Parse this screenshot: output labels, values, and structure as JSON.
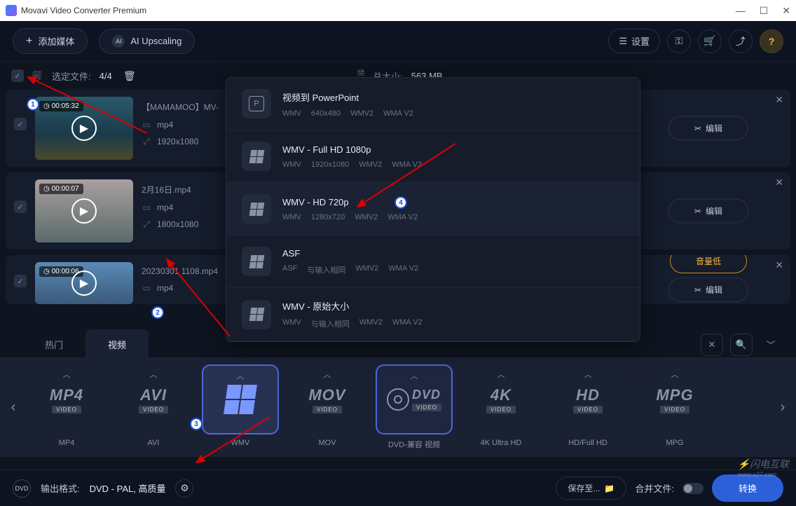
{
  "window": {
    "title": "Movavi Video Converter Premium"
  },
  "toolbar": {
    "add_media": "添加媒体",
    "ai_upscaling": "AI Upscaling",
    "settings": "设置"
  },
  "infobar": {
    "selected_label": "选定文件:",
    "selected_count": "4/4",
    "total_label": "总大小:",
    "total_size": "563 MB"
  },
  "files": [
    {
      "duration": "00:05:32",
      "name": "【MAMAMOO】MV-",
      "format": "mp4",
      "resolution": "1920x1080",
      "edit": "编辑"
    },
    {
      "duration": "00:00:07",
      "name": "2月16日.mp4",
      "format": "mp4",
      "resolution": "1800x1080",
      "edit": "编辑"
    },
    {
      "duration": "00:00:06",
      "name": "20230301 1108.mp4",
      "format": "mp4",
      "resolution": "",
      "warn": "音量低",
      "edit": "编辑"
    }
  ],
  "presets": [
    {
      "title": "视频到 PowerPoint",
      "specs": [
        "WMV",
        "640x480",
        "WMV2",
        "WMA V2"
      ],
      "icon": "ppt"
    },
    {
      "title": "WMV - Full HD 1080p",
      "specs": [
        "WMV",
        "1920x1080",
        "WMV2",
        "WMA V2"
      ],
      "icon": "win"
    },
    {
      "title": "WMV - HD 720p",
      "specs": [
        "WMV",
        "1280x720",
        "WMV2",
        "WMA V2"
      ],
      "icon": "win"
    },
    {
      "title": "ASF",
      "specs": [
        "ASF",
        "与输入相同",
        "WMV2",
        "WMA V2"
      ],
      "icon": "win"
    },
    {
      "title": "WMV - 原始大小",
      "specs": [
        "WMV",
        "与输入相同",
        "WMV2",
        "WMA V2"
      ],
      "icon": "win"
    }
  ],
  "tabs": {
    "hot": "热门",
    "video": "视频"
  },
  "formats": [
    {
      "big": "MP4",
      "sub": "VIDEO",
      "caption": "MP4",
      "kind": "text"
    },
    {
      "big": "AVI",
      "sub": "VIDEO",
      "caption": "AVI",
      "kind": "text"
    },
    {
      "big": "",
      "sub": "",
      "caption": "WMV",
      "kind": "win",
      "selected": true
    },
    {
      "big": "MOV",
      "sub": "VIDEO",
      "caption": "MOV",
      "kind": "text"
    },
    {
      "big": "DVD",
      "sub": "VIDEO",
      "caption": "DVD-兼容 视频",
      "kind": "dvd"
    },
    {
      "big": "4K",
      "sub": "VIDEO",
      "caption": "4K Ultra HD",
      "kind": "text"
    },
    {
      "big": "HD",
      "sub": "VIDEO",
      "caption": "HD/Full HD",
      "kind": "text"
    },
    {
      "big": "MPG",
      "sub": "VIDEO",
      "caption": "MPG",
      "kind": "text"
    }
  ],
  "footer": {
    "output_label": "输出格式:",
    "output_value": "DVD - PAL, 高质量",
    "save_to": "保存至...",
    "merge": "合并文件:",
    "convert": "转换"
  },
  "watermark": {
    "brand": "闪电互联",
    "url": "www.x27.com"
  }
}
